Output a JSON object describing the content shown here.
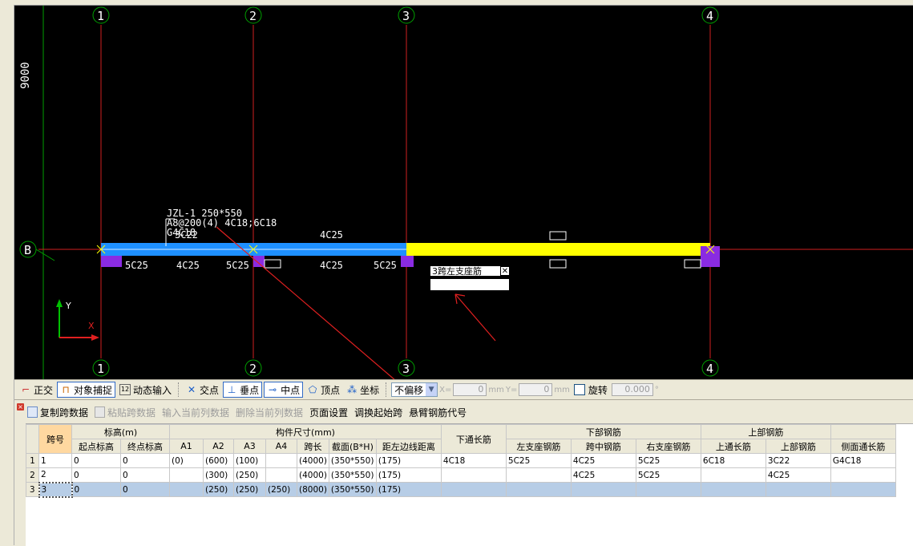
{
  "cad": {
    "dim_label": "9000",
    "axis_x_labels": [
      "1",
      "2",
      "3",
      "4"
    ],
    "axis_y_label": "B",
    "beam_label_lines": [
      "JZL-1 250*550",
      "A8@200(4) 4C18;6C18",
      "G4C18"
    ],
    "top_rebar_labels": [
      "3C22",
      "4C25"
    ],
    "bottom_rebar_labels": [
      "5C25",
      "4C25",
      "5C25",
      "4C25",
      "5C25"
    ],
    "edit_label": "3跨左支座筋",
    "edit_close": "✕",
    "coord_x": "X",
    "coord_y": "Y"
  },
  "snapbar": {
    "ortho": "正交",
    "snap": "对象捕捉",
    "dyn": "动态输入",
    "intersect": "交点",
    "perp": "垂点",
    "mid": "中点",
    "vertex": "顶点",
    "coord": "坐标",
    "offset": "不偏移",
    "x_label": "X=",
    "x_value": "0",
    "y_label": "Y=",
    "y_value": "0",
    "unit": "mm",
    "rotate": "旋转",
    "rotate_value": "0.000",
    "deg": "°"
  },
  "panel": {
    "copy_span": "复制跨数据",
    "paste_span": "粘贴跨数据",
    "input_col": "输入当前列数据",
    "delete_col": "删除当前列数据",
    "page_setup": "页面设置",
    "swap_start": "调换起始跨",
    "cantilever": "悬臂钢筋代号"
  },
  "grid": {
    "headers": {
      "span": "跨号",
      "elev": "标高(m)",
      "start_elev": "起点标高",
      "end_elev": "终点标高",
      "size": "构件尺寸(mm)",
      "a1": "A1",
      "a2": "A2",
      "a3": "A3",
      "a4": "A4",
      "span_len": "跨长",
      "section": "截面(B*H)",
      "edge_dist": "距左边线距离",
      "bottom_through": "下通长筋",
      "bottom_rebar": "下部钢筋",
      "left_support": "左支座钢筋",
      "mid_span": "跨中钢筋",
      "right_support": "右支座钢筋",
      "top_rebar": "上部钢筋",
      "top_through": "上通长筋",
      "top_rebar2": "上部钢筋",
      "side_through": "侧面通长筋"
    },
    "rows": [
      {
        "n": "1",
        "span": "1",
        "start": "0",
        "end": "0",
        "a1": "(0)",
        "a2": "(600)",
        "a3": "(100)",
        "a4": "",
        "len": "(4000)",
        "sec": "(350*550)",
        "dist": "(175)",
        "bthrough": "4C18",
        "lsup": "5C25",
        "mid": "4C25",
        "rsup": "5C25",
        "tthrough": "6C18",
        "top": "3C22",
        "side": "G4C18"
      },
      {
        "n": "2",
        "span": "2",
        "start": "0",
        "end": "0",
        "a1": "",
        "a2": "(300)",
        "a3": "(250)",
        "a4": "",
        "len": "(4000)",
        "sec": "(350*550)",
        "dist": "(175)",
        "bthrough": "",
        "lsup": "",
        "mid": "4C25",
        "rsup": "5C25",
        "tthrough": "",
        "top": "4C25",
        "side": ""
      },
      {
        "n": "3",
        "span": "3",
        "start": "0",
        "end": "0",
        "a1": "",
        "a2": "(250)",
        "a3": "(250)",
        "a4": "(250)",
        "len": "(8000)",
        "sec": "(350*550)",
        "dist": "(175)",
        "bthrough": "",
        "lsup": "",
        "mid": "",
        "rsup": "",
        "tthrough": "",
        "top": "",
        "side": ""
      }
    ]
  }
}
